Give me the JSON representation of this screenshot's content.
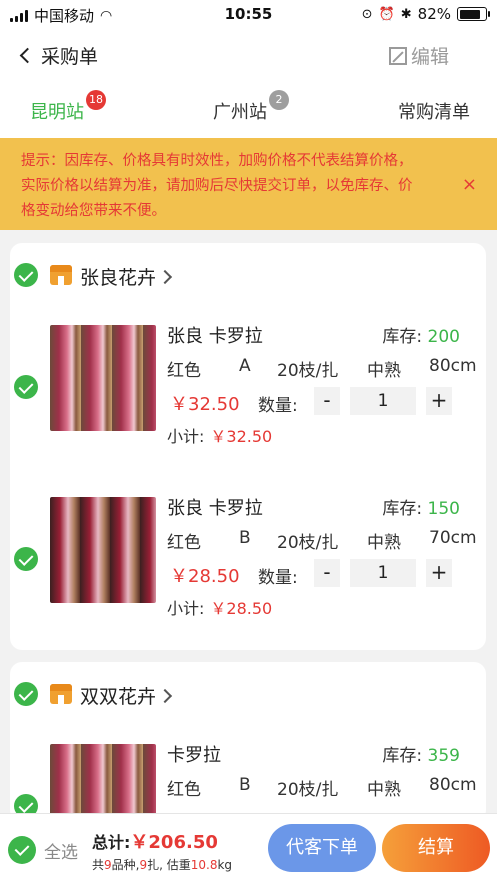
{
  "status_bar": {
    "carrier": "中国移动",
    "time": "10:55",
    "battery": "82%",
    "battery_level": 0.82
  },
  "nav": {
    "back_label": "采购单",
    "edit_label": "编辑"
  },
  "tabs": [
    {
      "label": "昆明站",
      "badge": "18",
      "active": true
    },
    {
      "label": "广州站",
      "badge": "2",
      "active": false
    },
    {
      "label": "常购清单",
      "badge": "",
      "active": false
    }
  ],
  "notice": {
    "line1": "提示：因库存、价格具有时效性，加购价格不代表结算价格，",
    "line2": "实际价格以结算为准，请加购后尽快提交订单，以免库存、价",
    "line3": "格变动给您带来不便。",
    "close": "×"
  },
  "stores": [
    {
      "name": "张良花卉",
      "items": [
        {
          "name": "张良 卡罗拉",
          "stock_label": "库存:",
          "stock": "200",
          "color": "红色",
          "grade": "A",
          "pack": "20枝/扎",
          "maturity": "中熟",
          "length": "80cm",
          "price": "￥32.50",
          "qty_label": "数量:",
          "qty": "1",
          "minus": "-",
          "plus": "+",
          "subtotal_label": "小计:",
          "subtotal": "￥32.50"
        },
        {
          "name": "张良 卡罗拉",
          "stock_label": "库存:",
          "stock": "150",
          "color": "红色",
          "grade": "B",
          "pack": "20枝/扎",
          "maturity": "中熟",
          "length": "70cm",
          "price": "￥28.50",
          "qty_label": "数量:",
          "qty": "1",
          "minus": "-",
          "plus": "+",
          "subtotal_label": "小计:",
          "subtotal": "￥28.50"
        }
      ]
    },
    {
      "name": "双双花卉",
      "items": [
        {
          "name": "卡罗拉",
          "stock_label": "库存:",
          "stock": "359",
          "color": "红色",
          "grade": "B",
          "pack": "20枝/扎",
          "maturity": "中熟",
          "length": "80cm"
        }
      ]
    }
  ],
  "bottom": {
    "select_all": "全选",
    "total_label": "总计:",
    "total": "￥206.50",
    "summary_pre": "共",
    "varieties": "9",
    "summary_mid1": "品种,",
    "bundles": "9",
    "summary_mid2": "扎, 估重",
    "weight": "10.8",
    "summary_unit": "kg",
    "proxy_order": "代客下单",
    "checkout": "结算"
  },
  "colors": {
    "accent_green": "#3cb54a",
    "price_red": "#e53935",
    "notice_bg": "#f2c14e",
    "proxy_blue": "#6b97e8",
    "checkout_orange": "#ee5a24"
  }
}
